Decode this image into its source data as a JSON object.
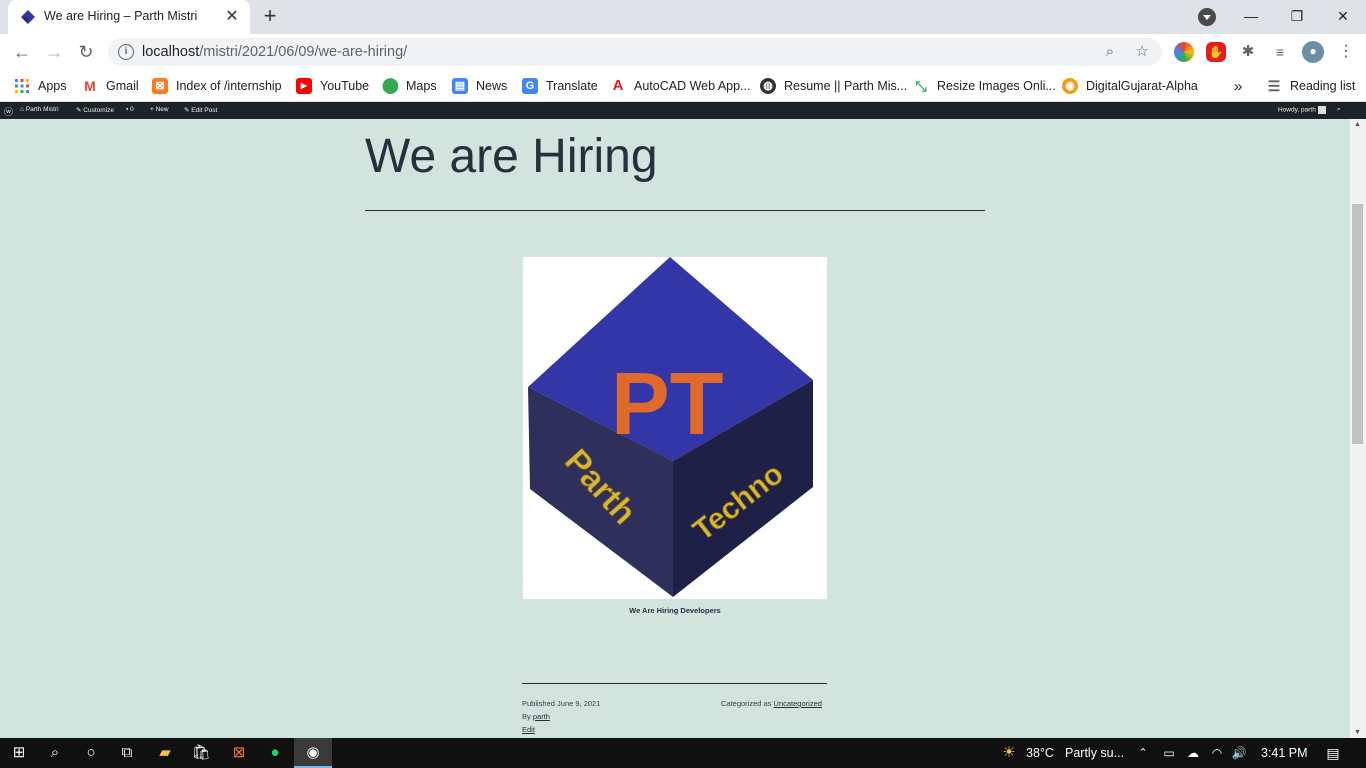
{
  "browser": {
    "tab_title": "We are Hiring – Parth Mistri",
    "tab_close": "✕",
    "new_tab": "+",
    "url_host": "localhost",
    "url_path": "/mistri/2021/06/09/we-are-hiring/",
    "window_controls": {
      "minimize": "—",
      "restore": "❐",
      "close": "✕"
    }
  },
  "bookmarks": {
    "items": [
      {
        "label": "Apps",
        "icon": "apps-grid-icon",
        "color": "#4285f4"
      },
      {
        "label": "Gmail",
        "icon": "gmail-icon",
        "color": "#ea4335"
      },
      {
        "label": "Index of /internship",
        "icon": "xampp-icon",
        "color": "#fb7a24"
      },
      {
        "label": "YouTube",
        "icon": "youtube-icon",
        "color": "#ff0000"
      },
      {
        "label": "Maps",
        "icon": "maps-icon",
        "color": "#34a853"
      },
      {
        "label": "News",
        "icon": "news-icon",
        "color": "#4285f4"
      },
      {
        "label": "Translate",
        "icon": "translate-icon",
        "color": "#4285f4"
      },
      {
        "label": "AutoCAD Web App...",
        "icon": "autocad-icon",
        "color": "#e51d1d"
      },
      {
        "label": "Resume || Parth Mis...",
        "icon": "globe-icon",
        "color": "#333333"
      },
      {
        "label": "Resize Images Onli...",
        "icon": "resize-icon",
        "color": "#2bb673"
      },
      {
        "label": "DigitalGujarat-Alpha",
        "icon": "digitalgujarat-icon",
        "color": "#f39c12"
      }
    ],
    "overflow": "»",
    "reading_list": "Reading list"
  },
  "wp_admin_bar": {
    "site_name": "Parth Mistri",
    "customize": "Customize",
    "comments_count": "0",
    "new": "New",
    "edit_post": "Edit Post",
    "howdy": "Howdy, parth"
  },
  "post": {
    "title": "We are Hiring",
    "logo_letters": "PT",
    "logo_word_left": "Parth",
    "logo_word_right": "Techno",
    "caption": "We Are Hiring Developers",
    "published": "Published June 9, 2021",
    "by_label": "By",
    "author": "parth",
    "edit": "Edit",
    "categorized_label": "Categorized as",
    "category": "Uncategorized"
  },
  "taskbar": {
    "weather_temp": "38°C",
    "weather_text": "Partly su...",
    "time": "3:41 PM"
  },
  "colors": {
    "page_bg": "#d1e4dd",
    "text": "#28303d",
    "wp_bar": "#1d2327",
    "cube_top": "#3236a6",
    "cube_left": "#2e2f5a",
    "cube_right": "#1f2048",
    "logo_orange": "#e06a2c",
    "logo_gold": "#d7b53a"
  }
}
